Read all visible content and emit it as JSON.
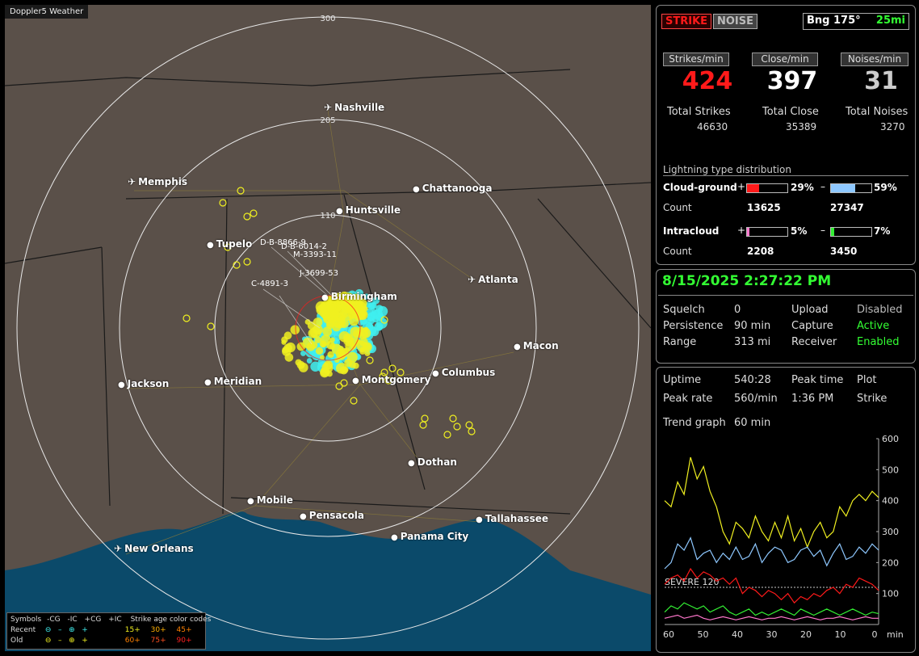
{
  "app_title": "Doppler5 Weather",
  "colors": {
    "strike_red": "#ff1a1a",
    "green": "#33ff33",
    "cyan": "#40f0f0",
    "yellow": "#f0f020",
    "cg_pos": "#ff1a1a",
    "cg_neg": "#8ec8ff",
    "ic_pos": "#ff77cc",
    "ic_neg": "#33ee33"
  },
  "map": {
    "range_labels": [
      "300",
      "205",
      "110"
    ],
    "cities": [
      {
        "name": "Nashville",
        "airport": true
      },
      {
        "name": "Memphis",
        "airport": true
      },
      {
        "name": "Chattanooga",
        "airport": false
      },
      {
        "name": "Huntsville",
        "airport": false
      },
      {
        "name": "Tupelo",
        "airport": false
      },
      {
        "name": "Atlanta",
        "airport": true
      },
      {
        "name": "Birmingham",
        "airport": false
      },
      {
        "name": "Macon",
        "airport": false
      },
      {
        "name": "Jackson",
        "airport": false
      },
      {
        "name": "Meridian",
        "airport": false
      },
      {
        "name": "Montgomery",
        "airport": false
      },
      {
        "name": "Columbus",
        "airport": false
      },
      {
        "name": "Dothan",
        "airport": false
      },
      {
        "name": "Mobile",
        "airport": false
      },
      {
        "name": "Pensacola",
        "airport": false
      },
      {
        "name": "Tallahassee",
        "airport": false
      },
      {
        "name": "Panama City",
        "airport": false
      },
      {
        "name": "New Orleans",
        "airport": true
      }
    ],
    "storm_labels": [
      "D-B-8866-9",
      "D-B-6014-2",
      "M-3393-11",
      "J-3699-53",
      "C-4891-3"
    ],
    "legend": {
      "symbols_label": "Symbols",
      "neg_cg": "-CG",
      "neg_ic": "-IC",
      "pos_cg": "+CG",
      "pos_ic": "+IC",
      "age_label": "Strike age color codes",
      "recent_label": "Recent",
      "old_label": "Old",
      "recent_ages": [
        "15+",
        "30+",
        "45+"
      ],
      "old_ages": [
        "60+",
        "75+",
        "90+"
      ]
    }
  },
  "top": {
    "strike_btn": "STRIKE",
    "noise_btn": "NOISE",
    "bearing": "Bng 175°",
    "distance": "25mi"
  },
  "rates": {
    "strikes_label": "Strikes/min",
    "close_label": "Close/min",
    "noises_label": "Noises/min",
    "strikes": "424",
    "close": "397",
    "noises": "31",
    "total_strikes_label": "Total Strikes",
    "total_close_label": "Total Close",
    "total_noises_label": "Total Noises",
    "total_strikes": "46630",
    "total_close": "35389",
    "total_noises": "3270"
  },
  "distribution": {
    "title": "Lightning type distribution",
    "cg_label": "Cloud-ground",
    "ic_label": "Intracloud",
    "count_label": "Count",
    "plus": "+",
    "minus": "–",
    "cg_pos_pct": "29%",
    "cg_neg_pct": "59%",
    "ic_pos_pct": "5%",
    "ic_neg_pct": "7%",
    "cg_pos_frac": 0.29,
    "cg_neg_frac": 0.59,
    "ic_pos_frac": 0.05,
    "ic_neg_frac": 0.07,
    "cg_pos_count": "13625",
    "cg_neg_count": "27347",
    "ic_pos_count": "2208",
    "ic_neg_count": "3450"
  },
  "status": {
    "datetime": "8/15/2025 2:27:22 PM",
    "squelch_label": "Squelch",
    "squelch": "0",
    "persistence_label": "Persistence",
    "persistence": "90 min",
    "range_label": "Range",
    "range": "313 mi",
    "upload_label": "Upload",
    "upload": "Disabled",
    "capture_label": "Capture",
    "capture": "Active",
    "receiver_label": "Receiver",
    "receiver": "Enabled"
  },
  "stats": {
    "uptime_label": "Uptime",
    "uptime": "540:28",
    "peak_time_label": "Peak time",
    "peak_time": "1:36 PM",
    "plot_label": "Plot",
    "plot": "Strike",
    "peak_rate_label": "Peak rate",
    "peak_rate": "560/min",
    "trend_label": "Trend graph",
    "trend": "60 min"
  },
  "chart_data": {
    "type": "line",
    "x_ticks": [
      "60",
      "50",
      "40",
      "30",
      "20",
      "10",
      "0"
    ],
    "x_unit": "min",
    "y_ticks": [
      "600",
      "500",
      "400",
      "300",
      "200",
      "100"
    ],
    "ylim": [
      0,
      600
    ],
    "severe_label": "SEVERE 120",
    "severe_value": 120,
    "series": [
      {
        "color": "#f0f020",
        "values": [
          400,
          380,
          460,
          420,
          540,
          470,
          510,
          430,
          380,
          300,
          260,
          330,
          310,
          280,
          350,
          300,
          270,
          330,
          280,
          350,
          270,
          310,
          250,
          300,
          330,
          280,
          300,
          380,
          350,
          400,
          420,
          400,
          430,
          410
        ]
      },
      {
        "color": "#8ec8ff",
        "values": [
          180,
          200,
          260,
          240,
          280,
          210,
          230,
          240,
          200,
          230,
          210,
          250,
          210,
          220,
          260,
          200,
          230,
          250,
          240,
          200,
          210,
          240,
          250,
          220,
          240,
          190,
          230,
          260,
          210,
          220,
          250,
          230,
          260,
          240
        ]
      },
      {
        "color": "#ff1a1a",
        "values": [
          130,
          150,
          160,
          140,
          180,
          150,
          170,
          160,
          140,
          150,
          130,
          150,
          100,
          120,
          110,
          90,
          110,
          100,
          80,
          100,
          70,
          90,
          80,
          100,
          90,
          110,
          120,
          100,
          130,
          120,
          150,
          140,
          130,
          110
        ]
      },
      {
        "color": "#33ee33",
        "values": [
          40,
          60,
          50,
          70,
          60,
          50,
          60,
          40,
          50,
          60,
          40,
          30,
          40,
          50,
          30,
          40,
          30,
          40,
          50,
          40,
          30,
          50,
          40,
          30,
          40,
          50,
          40,
          30,
          40,
          50,
          40,
          30,
          40,
          35
        ]
      },
      {
        "color": "#ff77cc",
        "values": [
          20,
          25,
          30,
          20,
          25,
          30,
          20,
          15,
          20,
          25,
          20,
          15,
          20,
          25,
          20,
          15,
          20,
          20,
          25,
          20,
          15,
          20,
          25,
          20,
          15,
          20,
          20,
          25,
          20,
          15,
          20,
          25,
          20,
          20
        ]
      }
    ]
  }
}
